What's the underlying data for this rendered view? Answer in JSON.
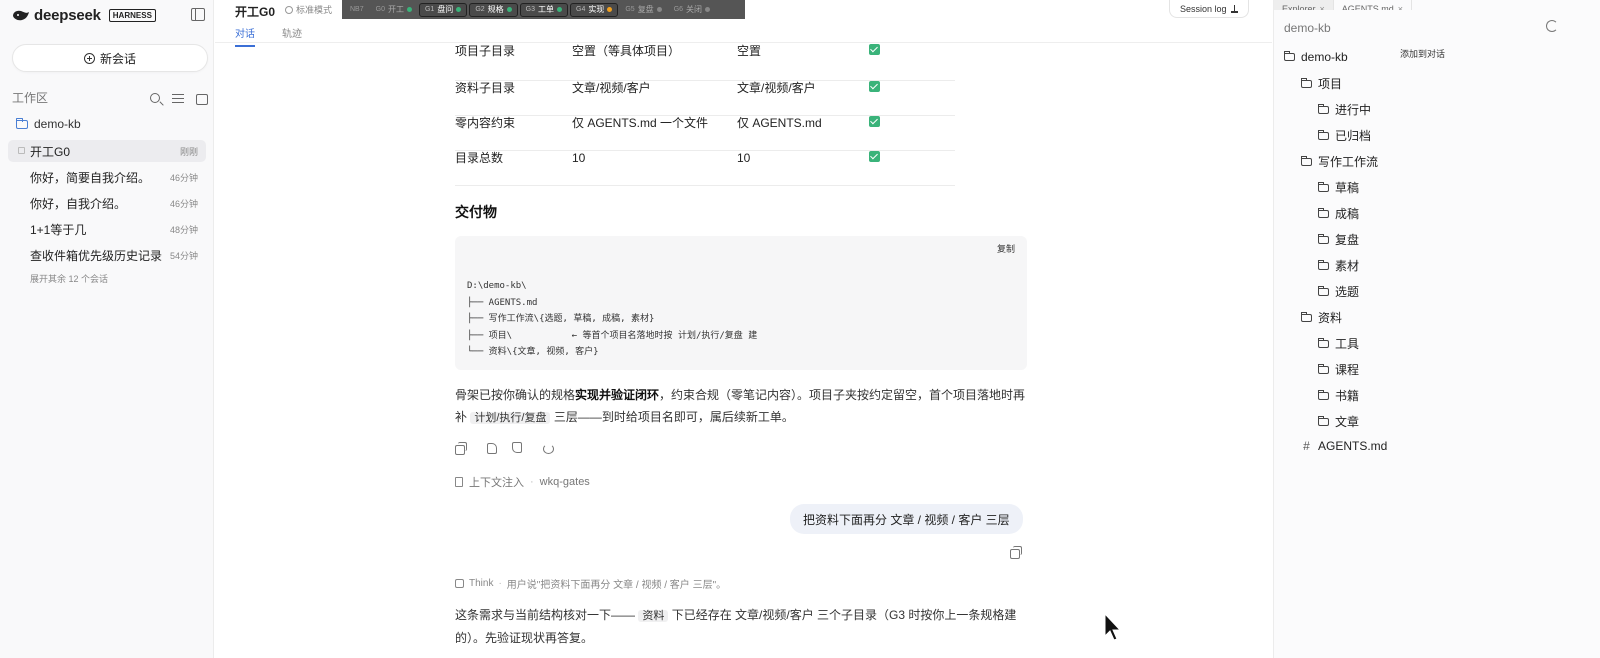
{
  "sidebar": {
    "brand_name": "deepseek",
    "brand_badge": "HARNESS",
    "new_chat_label": "新会话",
    "workspace_label": "工作区",
    "project_name": "demo-kb",
    "sessions": [
      {
        "title": "开工G0",
        "time": "刚刚",
        "active": true
      },
      {
        "title": "你好，简要自我介绍。",
        "time": "46分钟"
      },
      {
        "title": "你好，自我介绍。",
        "time": "46分钟"
      },
      {
        "title": "1+1等于几",
        "time": "48分钟"
      },
      {
        "title": "查收件箱优先级历史记录",
        "time": "54分钟"
      }
    ],
    "expand_more": "展开其余 12 个会话"
  },
  "topbar": {
    "title": "开工G0",
    "mode": "标准模式",
    "tabs": [
      "对话",
      "轨迹"
    ],
    "session_log": "Session log",
    "gates": [
      {
        "id": "NB7",
        "label": "",
        "color": ""
      },
      {
        "id": "G0",
        "label": "开工",
        "color": "#3ab37a",
        "boxed": false
      },
      {
        "id": "G1",
        "label": "盘问",
        "color": "#3ab37a",
        "boxed": true
      },
      {
        "id": "G2",
        "label": "规格",
        "color": "#3ab37a",
        "boxed": true
      },
      {
        "id": "G3",
        "label": "工单",
        "color": "#3ab37a",
        "boxed": true
      },
      {
        "id": "G4",
        "label": "实现",
        "color": "#f0a020",
        "boxed": true
      },
      {
        "id": "G5",
        "label": "复盘",
        "color": "#888888",
        "boxed": false
      },
      {
        "id": "G6",
        "label": "关闭",
        "color": "#888888",
        "boxed": false
      }
    ]
  },
  "main": {
    "table_rows": [
      [
        "项目子目录",
        "空置（等具体项目）",
        "空置"
      ],
      [
        "资料子目录",
        "文章/视频/客户",
        "文章/视频/客户"
      ],
      [
        "零内容约束",
        "仅 AGENTS.md 一个文件",
        "仅 AGENTS.md"
      ],
      [
        "目录总数",
        "10",
        "10"
      ]
    ],
    "section_heading": "交付物",
    "code_copy_label": "复制",
    "code_lines": [
      "D:\\demo-kb\\",
      "├── AGENTS.md",
      "├── 写作工作流\\{选题, 草稿, 成稿, 素材}",
      "├── 项目\\           ← 等首个项目名落地时按 计划/执行/复盘 建",
      "└── 资料\\{文章, 视频, 客户}"
    ],
    "para_1a": "骨架已按你确认的规格",
    "para_1b": "实现并验证闭环",
    "para_1c": "，约束合规（零笔记内容）。项目子夹按约定留空，首个项目落地时再补",
    "para_1_code": "计划/执行/复盘",
    "para_1d": "三层——到时给项目名即可，属后续新工单。",
    "context_label": "上下文注入",
    "context_source": "wkq-gates",
    "user_message": "把资料下面再分 文章 / 视频 / 客户 三层",
    "think_label": "Think",
    "think_summary": "用户说\"把资料下面再分 文章 / 视频 / 客户 三层\"。",
    "para_2a": "这条需求与当前结构核对一下——",
    "para_2_code": "资料",
    "para_2b": "下已经存在 文章/视频/客户 三个子目录（G3 时按你上一条规格建的）。先验证现状再答复。"
  },
  "explorer": {
    "tabs": [
      "Explorer",
      "AGENTS.md"
    ],
    "root_label": "demo-kb",
    "add_to_chat": "添加到对话",
    "tree": [
      {
        "name": "demo-kb",
        "depth": 0,
        "type": "folder"
      },
      {
        "name": "项目",
        "depth": 1,
        "type": "folder"
      },
      {
        "name": "进行中",
        "depth": 2,
        "type": "folder"
      },
      {
        "name": "已归档",
        "depth": 2,
        "type": "folder"
      },
      {
        "name": "写作工作流",
        "depth": 1,
        "type": "folder"
      },
      {
        "name": "草稿",
        "depth": 2,
        "type": "folder"
      },
      {
        "name": "成稿",
        "depth": 2,
        "type": "folder"
      },
      {
        "name": "复盘",
        "depth": 2,
        "type": "folder"
      },
      {
        "name": "素材",
        "depth": 2,
        "type": "folder"
      },
      {
        "name": "选题",
        "depth": 2,
        "type": "folder"
      },
      {
        "name": "资料",
        "depth": 1,
        "type": "folder"
      },
      {
        "name": "工具",
        "depth": 2,
        "type": "folder"
      },
      {
        "name": "课程",
        "depth": 2,
        "type": "folder"
      },
      {
        "name": "书籍",
        "depth": 2,
        "type": "folder"
      },
      {
        "name": "文章",
        "depth": 2,
        "type": "folder"
      },
      {
        "name": "AGENTS.md",
        "depth": 1,
        "type": "file"
      }
    ]
  },
  "colors": {
    "accent": "#3b6fd6",
    "success": "#3ab37a",
    "pending": "#f0a020"
  }
}
